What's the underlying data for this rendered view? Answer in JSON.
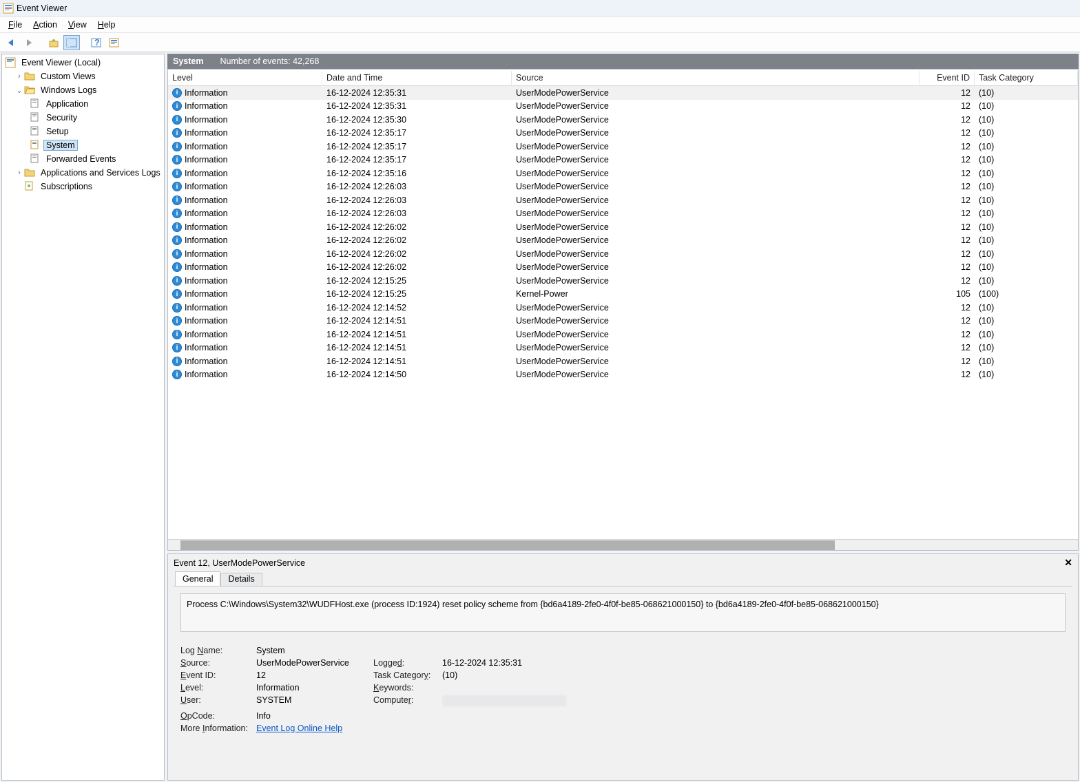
{
  "window": {
    "title": "Event Viewer"
  },
  "menu": {
    "file": "File",
    "action": "Action",
    "view": "View",
    "help": "Help"
  },
  "tree": {
    "root": "Event Viewer (Local)",
    "custom_views": "Custom Views",
    "windows_logs": "Windows Logs",
    "logs": {
      "application": "Application",
      "security": "Security",
      "setup": "Setup",
      "system": "System",
      "forwarded": "Forwarded Events"
    },
    "apps_services": "Applications and Services Logs",
    "subscriptions": "Subscriptions"
  },
  "header": {
    "log_name": "System",
    "count_label": "Number of events: 42,268"
  },
  "columns": {
    "level": "Level",
    "datetime": "Date and Time",
    "source": "Source",
    "eventid": "Event ID",
    "task": "Task Category"
  },
  "rows": [
    {
      "level": "Information",
      "dt": "16-12-2024 12:35:31",
      "src": "UserModePowerService",
      "id": "12",
      "task": "(10)"
    },
    {
      "level": "Information",
      "dt": "16-12-2024 12:35:31",
      "src": "UserModePowerService",
      "id": "12",
      "task": "(10)"
    },
    {
      "level": "Information",
      "dt": "16-12-2024 12:35:30",
      "src": "UserModePowerService",
      "id": "12",
      "task": "(10)"
    },
    {
      "level": "Information",
      "dt": "16-12-2024 12:35:17",
      "src": "UserModePowerService",
      "id": "12",
      "task": "(10)"
    },
    {
      "level": "Information",
      "dt": "16-12-2024 12:35:17",
      "src": "UserModePowerService",
      "id": "12",
      "task": "(10)"
    },
    {
      "level": "Information",
      "dt": "16-12-2024 12:35:17",
      "src": "UserModePowerService",
      "id": "12",
      "task": "(10)"
    },
    {
      "level": "Information",
      "dt": "16-12-2024 12:35:16",
      "src": "UserModePowerService",
      "id": "12",
      "task": "(10)"
    },
    {
      "level": "Information",
      "dt": "16-12-2024 12:26:03",
      "src": "UserModePowerService",
      "id": "12",
      "task": "(10)"
    },
    {
      "level": "Information",
      "dt": "16-12-2024 12:26:03",
      "src": "UserModePowerService",
      "id": "12",
      "task": "(10)"
    },
    {
      "level": "Information",
      "dt": "16-12-2024 12:26:03",
      "src": "UserModePowerService",
      "id": "12",
      "task": "(10)"
    },
    {
      "level": "Information",
      "dt": "16-12-2024 12:26:02",
      "src": "UserModePowerService",
      "id": "12",
      "task": "(10)"
    },
    {
      "level": "Information",
      "dt": "16-12-2024 12:26:02",
      "src": "UserModePowerService",
      "id": "12",
      "task": "(10)"
    },
    {
      "level": "Information",
      "dt": "16-12-2024 12:26:02",
      "src": "UserModePowerService",
      "id": "12",
      "task": "(10)"
    },
    {
      "level": "Information",
      "dt": "16-12-2024 12:26:02",
      "src": "UserModePowerService",
      "id": "12",
      "task": "(10)"
    },
    {
      "level": "Information",
      "dt": "16-12-2024 12:15:25",
      "src": "UserModePowerService",
      "id": "12",
      "task": "(10)"
    },
    {
      "level": "Information",
      "dt": "16-12-2024 12:15:25",
      "src": "Kernel-Power",
      "id": "105",
      "task": "(100)"
    },
    {
      "level": "Information",
      "dt": "16-12-2024 12:14:52",
      "src": "UserModePowerService",
      "id": "12",
      "task": "(10)"
    },
    {
      "level": "Information",
      "dt": "16-12-2024 12:14:51",
      "src": "UserModePowerService",
      "id": "12",
      "task": "(10)"
    },
    {
      "level": "Information",
      "dt": "16-12-2024 12:14:51",
      "src": "UserModePowerService",
      "id": "12",
      "task": "(10)"
    },
    {
      "level": "Information",
      "dt": "16-12-2024 12:14:51",
      "src": "UserModePowerService",
      "id": "12",
      "task": "(10)"
    },
    {
      "level": "Information",
      "dt": "16-12-2024 12:14:51",
      "src": "UserModePowerService",
      "id": "12",
      "task": "(10)"
    },
    {
      "level": "Information",
      "dt": "16-12-2024 12:14:50",
      "src": "UserModePowerService",
      "id": "12",
      "task": "(10)"
    }
  ],
  "detail": {
    "title": "Event 12, UserModePowerService",
    "tabs": {
      "general": "General",
      "details": "Details"
    },
    "message": "Process C:\\Windows\\System32\\WUDFHost.exe (process ID:1924) reset policy scheme from {bd6a4189-2fe0-4f0f-be85-068621000150} to {bd6a4189-2fe0-4f0f-be85-068621000150}",
    "labels": {
      "logname": "Log Name:",
      "source": "Source:",
      "eventid": "Event ID:",
      "level": "Level:",
      "user": "User:",
      "opcode": "OpCode:",
      "moreinfo": "More Information:",
      "logged": "Logged:",
      "taskcat": "Task Category:",
      "keywords": "Keywords:",
      "computer": "Computer:"
    },
    "values": {
      "logname": "System",
      "source": "UserModePowerService",
      "eventid": "12",
      "level": "Information",
      "user": "SYSTEM",
      "opcode": "Info",
      "logged": "16-12-2024 12:35:31",
      "taskcat": "(10)",
      "keywords": "",
      "computer": ""
    },
    "link": "Event Log Online Help"
  }
}
